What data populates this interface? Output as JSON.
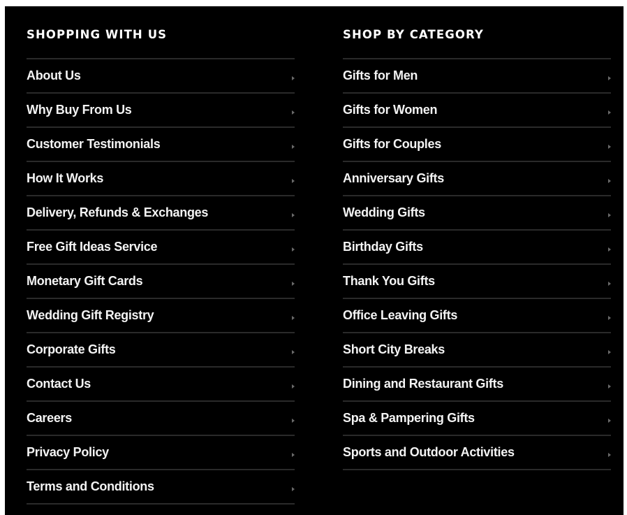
{
  "shopping_with_us": {
    "title": "SHOPPING WITH US",
    "items": [
      {
        "label": "About Us"
      },
      {
        "label": "Why Buy From Us"
      },
      {
        "label": "Customer Testimonials"
      },
      {
        "label": "How It Works"
      },
      {
        "label": "Delivery, Refunds & Exchanges"
      },
      {
        "label": "Free Gift Ideas Service"
      },
      {
        "label": "Monetary Gift Cards"
      },
      {
        "label": "Wedding Gift Registry"
      },
      {
        "label": "Corporate Gifts"
      },
      {
        "label": "Contact Us"
      },
      {
        "label": "Careers"
      },
      {
        "label": "Privacy Policy"
      },
      {
        "label": "Terms and Conditions"
      }
    ]
  },
  "shop_by_category": {
    "title": "SHOP BY CATEGORY",
    "items": [
      {
        "label": "Gifts for Men"
      },
      {
        "label": "Gifts for Women"
      },
      {
        "label": "Gifts for Couples"
      },
      {
        "label": "Anniversary Gifts"
      },
      {
        "label": "Wedding Gifts"
      },
      {
        "label": "Birthday Gifts"
      },
      {
        "label": "Thank You Gifts"
      },
      {
        "label": "Office Leaving Gifts"
      },
      {
        "label": "Short City Breaks"
      },
      {
        "label": "Dining and Restaurant Gifts"
      },
      {
        "label": "Spa & Pampering Gifts"
      },
      {
        "label": "Sports and Outdoor Activities"
      }
    ]
  },
  "icons": {
    "item_arrow": "chevron-right-icon"
  },
  "colors": {
    "background": "#000000",
    "text": "#f3f3f3",
    "divider": "#2a2a2a",
    "arrow": "#6a6a6a"
  }
}
